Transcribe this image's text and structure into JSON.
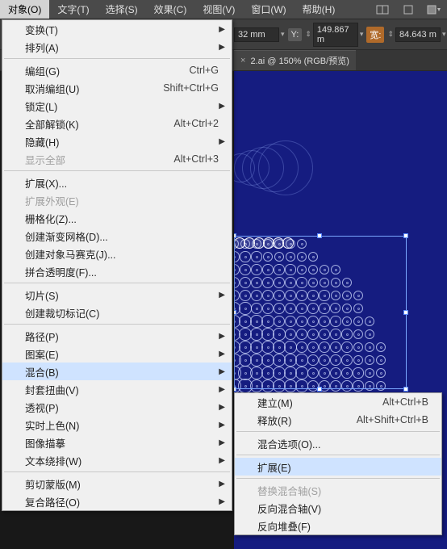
{
  "menubar": {
    "items": [
      "对象(O)",
      "文字(T)",
      "选择(S)",
      "效果(C)",
      "视图(V)",
      "窗口(W)",
      "帮助(H)"
    ]
  },
  "toolbar": {
    "x_suffix": "32 mm",
    "y_label": "Y:",
    "y_value": "149.867 m",
    "w_label": "宽:",
    "w_value": "84.643 m"
  },
  "tab": {
    "title": "2.ai @ 150% (RGB/预览)"
  },
  "main_menu": [
    {
      "type": "item",
      "label": "变换(T)",
      "submenu": true
    },
    {
      "type": "item",
      "label": "排列(A)",
      "submenu": true
    },
    {
      "type": "sep"
    },
    {
      "type": "item",
      "label": "编组(G)",
      "shortcut": "Ctrl+G"
    },
    {
      "type": "item",
      "label": "取消编组(U)",
      "shortcut": "Shift+Ctrl+G"
    },
    {
      "type": "item",
      "label": "锁定(L)",
      "submenu": true
    },
    {
      "type": "item",
      "label": "全部解锁(K)",
      "shortcut": "Alt+Ctrl+2"
    },
    {
      "type": "item",
      "label": "隐藏(H)",
      "submenu": true
    },
    {
      "type": "item",
      "label": "显示全部",
      "shortcut": "Alt+Ctrl+3",
      "disabled": true
    },
    {
      "type": "sep"
    },
    {
      "type": "item",
      "label": "扩展(X)..."
    },
    {
      "type": "item",
      "label": "扩展外观(E)",
      "disabled": true
    },
    {
      "type": "item",
      "label": "栅格化(Z)..."
    },
    {
      "type": "item",
      "label": "创建渐变网格(D)..."
    },
    {
      "type": "item",
      "label": "创建对象马赛克(J)..."
    },
    {
      "type": "item",
      "label": "拼合透明度(F)..."
    },
    {
      "type": "sep"
    },
    {
      "type": "item",
      "label": "切片(S)",
      "submenu": true
    },
    {
      "type": "item",
      "label": "创建裁切标记(C)"
    },
    {
      "type": "sep"
    },
    {
      "type": "item",
      "label": "路径(P)",
      "submenu": true
    },
    {
      "type": "item",
      "label": "图案(E)",
      "submenu": true
    },
    {
      "type": "item",
      "label": "混合(B)",
      "submenu": true,
      "highlight": true
    },
    {
      "type": "item",
      "label": "封套扭曲(V)",
      "submenu": true
    },
    {
      "type": "item",
      "label": "透视(P)",
      "submenu": true
    },
    {
      "type": "item",
      "label": "实时上色(N)",
      "submenu": true
    },
    {
      "type": "item",
      "label": "图像描摹",
      "submenu": true
    },
    {
      "type": "item",
      "label": "文本绕排(W)",
      "submenu": true
    },
    {
      "type": "sep"
    },
    {
      "type": "item",
      "label": "剪切蒙版(M)",
      "submenu": true
    },
    {
      "type": "item",
      "label": "复合路径(O)",
      "submenu": true
    }
  ],
  "sub_menu": [
    {
      "type": "item",
      "label": "建立(M)",
      "shortcut": "Alt+Ctrl+B"
    },
    {
      "type": "item",
      "label": "释放(R)",
      "shortcut": "Alt+Shift+Ctrl+B"
    },
    {
      "type": "sep"
    },
    {
      "type": "item",
      "label": "混合选项(O)..."
    },
    {
      "type": "sep"
    },
    {
      "type": "item",
      "label": "扩展(E)",
      "highlight": true
    },
    {
      "type": "sep"
    },
    {
      "type": "item",
      "label": "替换混合轴(S)",
      "disabled": true
    },
    {
      "type": "item",
      "label": "反向混合轴(V)"
    },
    {
      "type": "item",
      "label": "反向堆叠(F)"
    }
  ]
}
